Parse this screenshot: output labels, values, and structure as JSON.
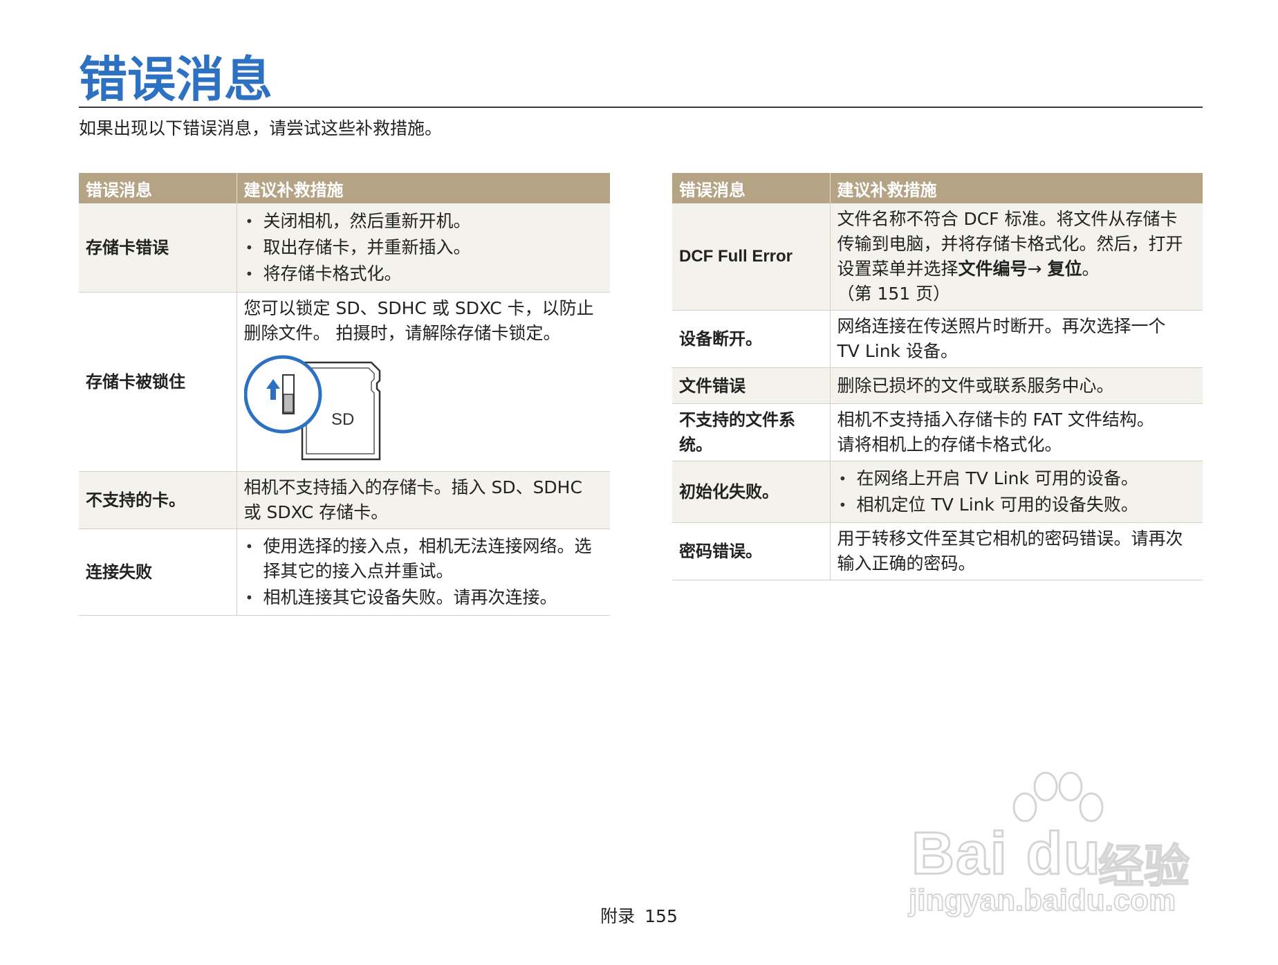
{
  "title": "错误消息",
  "intro": "如果出现以下错误消息，请尝试这些补救措施。",
  "tables": {
    "left": {
      "headers": [
        "错误消息",
        "建议补救措施"
      ],
      "rows": [
        {
          "message": "存储卡错误",
          "bullets": [
            "关闭相机，然后重新开机。",
            "取出存储卡，并重新插入。",
            "将存储卡格式化。"
          ]
        },
        {
          "message": "存储卡被锁住",
          "text_lines": [
            "您可以锁定 SD、SDHC 或 SDXC 卡，以防止",
            "删除文件。 拍摄时，请解除存储卡锁定。"
          ],
          "figure_label": "SD"
        },
        {
          "message": "不支持的卡。",
          "text_lines": [
            "相机不支持插入的存储卡。插入 SD、SDHC",
            "或 SDXC 存储卡。"
          ]
        },
        {
          "message": "连接失败",
          "bullets": [
            "使用选择的接入点，相机无法连接网络。选择其它的接入点并重试。",
            "相机连接其它设备失败。请再次连接。"
          ]
        }
      ]
    },
    "right": {
      "headers": [
        "错误消息",
        "建议补救措施"
      ],
      "rows": [
        {
          "message": "DCF Full Error",
          "text_lines": [
            "文件名称不符合 DCF 标准。将文件从存储卡",
            "传输到电脑，并将存储卡格式化。然后，打开"
          ],
          "line3_prefix": "设置菜单并选择",
          "line3_bold1": "文件编号",
          "line3_arrow": "→ ",
          "line3_bold2": "复位",
          "line3_suffix": "。",
          "note": "（第 151 页）"
        },
        {
          "message": "设备断开。",
          "text_lines": [
            "网络连接在传送照片时断开。再次选择一个",
            "TV Link 设备。"
          ]
        },
        {
          "message": "文件错误",
          "text_lines": [
            "删除已损坏的文件或联系服务中心。"
          ]
        },
        {
          "message": "不支持的文件系统。",
          "text_lines": [
            "相机不支持插入存储卡的 FAT 文件结构。",
            "请将相机上的存储卡格式化。"
          ]
        },
        {
          "message": "初始化失败。",
          "bullets": [
            "在网络上开启 TV Link 可用的设备。",
            "相机定位 TV Link 可用的设备失败。"
          ]
        },
        {
          "message": "密码错误。",
          "text_lines": [
            "用于转移文件至其它相机的密码错误。请再次",
            "输入正确的密码。"
          ]
        }
      ]
    }
  },
  "footer": {
    "section": "附录",
    "page_number": "155"
  },
  "watermark": {
    "brand": "Bai du",
    "brand_cn": "经验",
    "url": "jingyan.baidu.com"
  },
  "colors": {
    "title": "#2d72c2",
    "header_bg": "#b5a385",
    "row_shade": "#f4f2ed",
    "figure_circle": "#2d72c2"
  }
}
